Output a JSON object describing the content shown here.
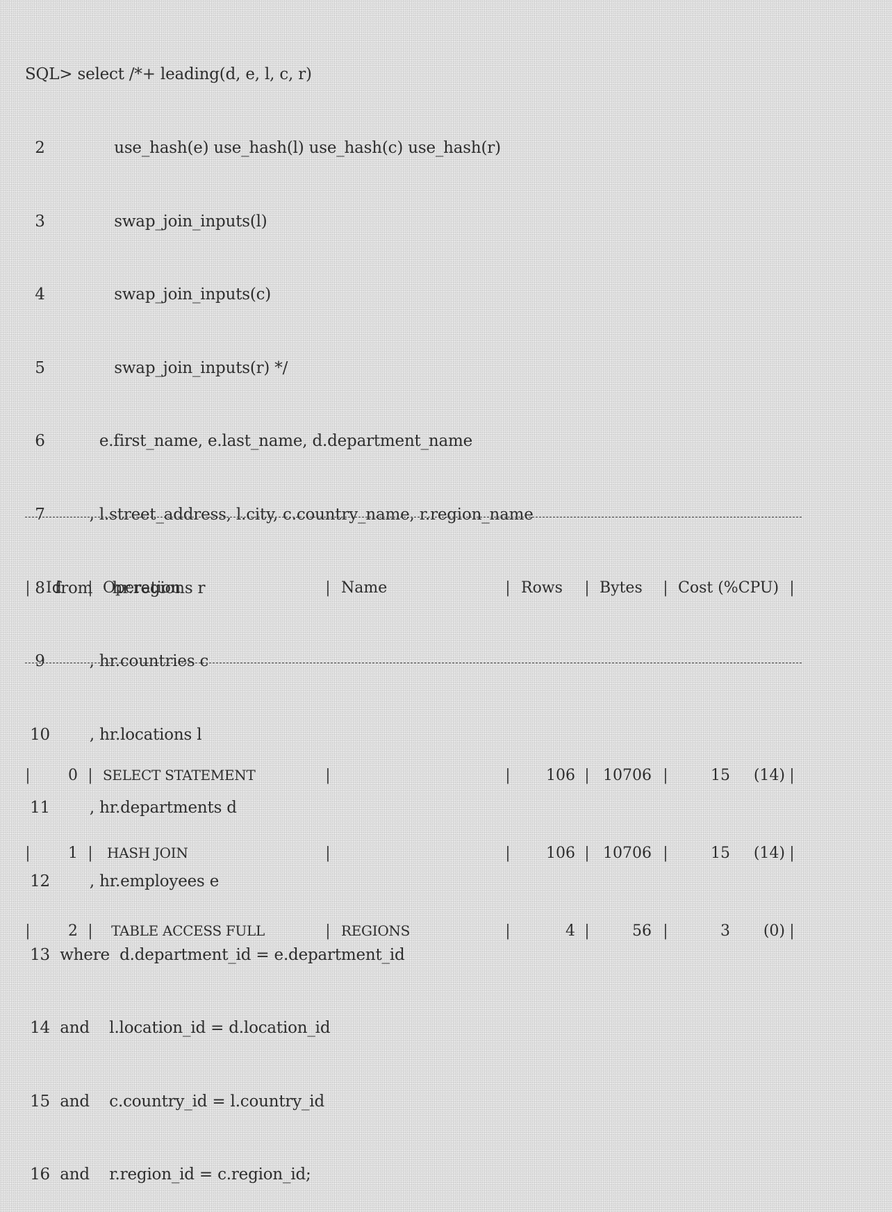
{
  "sql_listing": {
    "lines": [
      "SQL> select /*+ leading(d, e, l, c, r)",
      "  2              use_hash(e) use_hash(l) use_hash(c) use_hash(r)",
      "  3              swap_join_inputs(l)",
      "  4              swap_join_inputs(c)",
      "  5              swap_join_inputs(r) */",
      "  6           e.first_name, e.last_name, d.department_name",
      "  7         , l.street_address, l.city, c.country_name, r.region_name",
      "  8  from    hr.regions r",
      "  9         , hr.countries c",
      " 10        , hr.locations l",
      " 11        , hr.departments d",
      " 12        , hr.employees e",
      " 13  where  d.department_id = e.department_id",
      " 14  and    l.location_id = d.location_id",
      " 15  and    c.country_id = l.country_id",
      " 16  and    r.region_id = c.region_id;"
    ]
  },
  "plan_table": {
    "headers": {
      "id": "Id",
      "operation": "Operation",
      "name": "Name",
      "rows": "Rows",
      "bytes": "Bytes",
      "cost": "Cost (%CPU)"
    },
    "rows": [
      {
        "id": "0",
        "operation": "SELECT STATEMENT",
        "name": "",
        "rows": "106",
        "bytes": "10706",
        "cost": "15",
        "cpu": "(14)"
      },
      {
        "id": "1",
        "operation": " HASH JOIN",
        "name": "",
        "rows": "106",
        "bytes": "10706",
        "cost": "15",
        "cpu": "(14)"
      },
      {
        "id": "2",
        "operation": "  TABLE ACCESS FULL",
        "name": "REGIONS",
        "rows": "4",
        "bytes": "56",
        "cost": "3",
        "cpu": "(0)"
      }
    ]
  }
}
